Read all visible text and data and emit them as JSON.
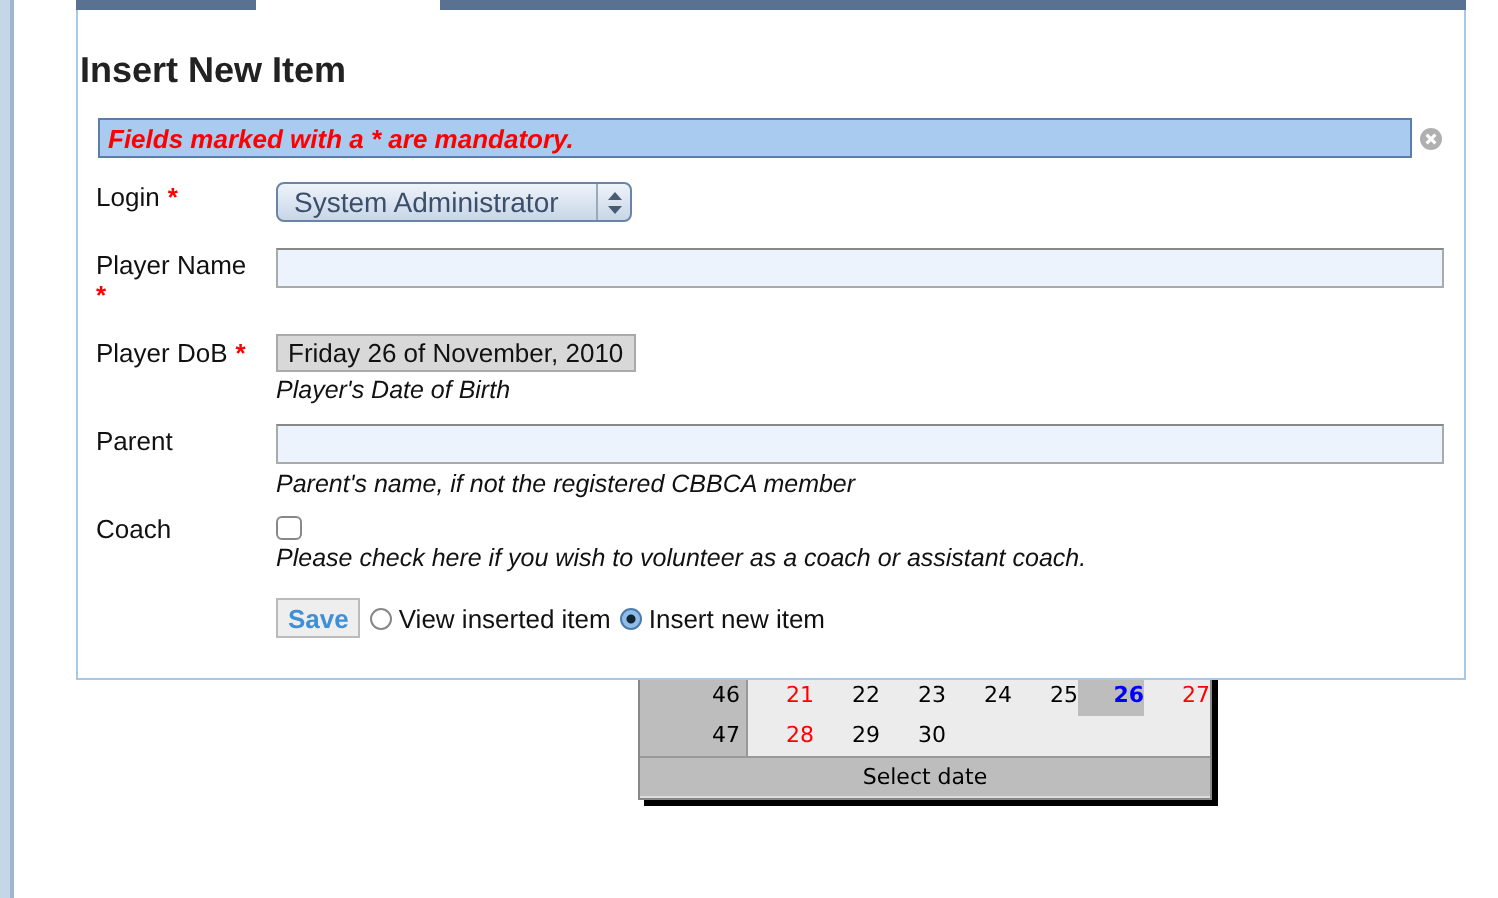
{
  "dialog": {
    "title": "Insert New Item",
    "notice": "Fields marked with a * are mandatory.",
    "fields": [
      {
        "kind": "select",
        "label": "Login",
        "mark": "*",
        "value": "System Administrator"
      },
      {
        "kind": "text",
        "label": "Player Name",
        "mark": "*",
        "mark_on_new_line": true
      },
      {
        "kind": "date",
        "label": "Player DoB",
        "mark": "*",
        "value": "Friday 26 of November, 2010",
        "hint": "Player's Date of Birth"
      },
      {
        "kind": "text",
        "label": "Parent",
        "hint": "Parent's name, if not the registered CBBCA member"
      },
      {
        "kind": "checkbox",
        "label": "Coach",
        "checked": false,
        "hint": "Please check here if you wish to volunteer as a coach or assistant coach."
      }
    ],
    "save": "Save",
    "after_save": [
      {
        "label": "View inserted item",
        "selected": false
      },
      {
        "label": "Insert new item",
        "selected": true
      }
    ]
  },
  "calendar": {
    "weeks": [
      {
        "week": "46",
        "days": [
          {
            "day": "21",
            "weekend": true,
            "selected": false
          },
          {
            "day": "22",
            "weekend": false,
            "selected": false
          },
          {
            "day": "23",
            "weekend": false,
            "selected": false
          },
          {
            "day": "24",
            "weekend": false,
            "selected": false
          },
          {
            "day": "25",
            "weekend": false,
            "selected": false
          },
          {
            "day": "26",
            "weekend": false,
            "selected": true
          },
          {
            "day": "27",
            "weekend": true,
            "selected": false
          }
        ]
      },
      {
        "week": "47",
        "days": [
          {
            "day": "28",
            "weekend": true,
            "selected": false
          },
          {
            "day": "29",
            "weekend": false,
            "selected": false
          },
          {
            "day": "30",
            "weekend": false,
            "selected": false
          }
        ]
      }
    ],
    "footer": "Select date"
  }
}
